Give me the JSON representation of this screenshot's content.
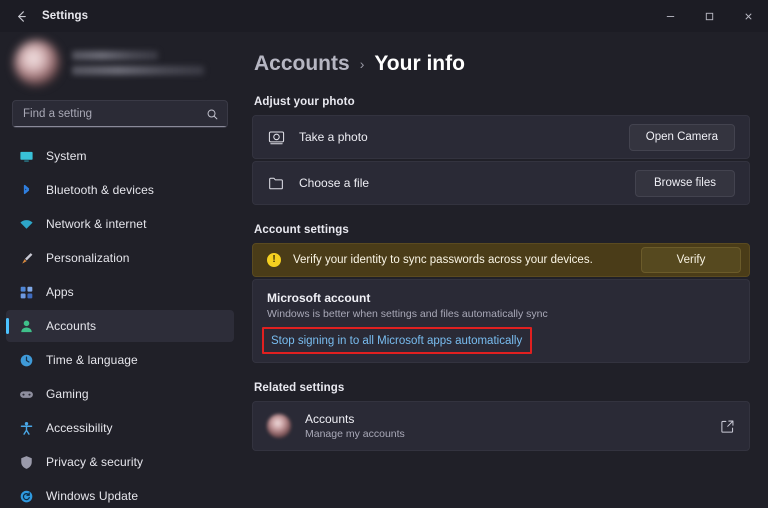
{
  "titlebar": {
    "back_icon": "back-arrow-icon",
    "title": "Settings",
    "minimize": "─",
    "maximize": "□",
    "close": "✕"
  },
  "sidebar": {
    "profile": {
      "avatar": "user-avatar-blurred",
      "name_blurred": true,
      "email_blurred": true
    },
    "search": {
      "placeholder": "Find a setting",
      "icon": "search-icon"
    },
    "items": [
      {
        "label": "System",
        "icon": "system-monitor-icon",
        "color": "#39c1d8",
        "active": false
      },
      {
        "label": "Bluetooth & devices",
        "icon": "bluetooth-icon",
        "color": "#2f7fe0",
        "active": false
      },
      {
        "label": "Network & internet",
        "icon": "wifi-icon",
        "color": "#2ea6c8",
        "active": false
      },
      {
        "label": "Personalization",
        "icon": "paintbrush-icon",
        "color": "#d98a3f",
        "active": false
      },
      {
        "label": "Apps",
        "icon": "apps-grid-icon",
        "color": "#4f86d6",
        "active": false
      },
      {
        "label": "Accounts",
        "icon": "account-person-icon",
        "color": "#3fc08a",
        "active": true
      },
      {
        "label": "Time & language",
        "icon": "clock-icon",
        "color": "#3f9ad8",
        "active": false
      },
      {
        "label": "Gaming",
        "icon": "gamepad-icon",
        "color": "#8e8e9e",
        "active": false
      },
      {
        "label": "Accessibility",
        "icon": "accessibility-person-icon",
        "color": "#4aa8e8",
        "active": false
      },
      {
        "label": "Privacy & security",
        "icon": "shield-icon",
        "color": "#9a9aaa",
        "active": false
      },
      {
        "label": "Windows Update",
        "icon": "update-refresh-icon",
        "color": "#2f9ae0",
        "active": false
      }
    ]
  },
  "main": {
    "breadcrumb": {
      "parent": "Accounts",
      "separator": "›",
      "current": "Your info"
    },
    "adjust_photo": {
      "section_title": "Adjust your photo",
      "rows": [
        {
          "label": "Take a photo",
          "icon": "camera-icon",
          "button": "Open Camera"
        },
        {
          "label": "Choose a file",
          "icon": "folder-icon",
          "button": "Browse files"
        }
      ]
    },
    "account_settings": {
      "section_title": "Account settings",
      "banner": {
        "icon": "warning-icon",
        "icon_glyph": "!",
        "text": "Verify your identity to sync passwords across your devices.",
        "button": "Verify",
        "background_color": "#4a3c18"
      },
      "microsoft_account": {
        "title": "Microsoft account",
        "subtitle": "Windows is better when settings and files automatically sync",
        "link": "Stop signing in to all Microsoft apps automatically",
        "link_color": "#79bdf0",
        "annotation_color": "#e02020"
      }
    },
    "related_settings": {
      "section_title": "Related settings",
      "row": {
        "avatar": "account-avatar-blurred",
        "title": "Accounts",
        "subtitle": "Manage my accounts",
        "icon": "external-link-icon"
      }
    }
  },
  "accent_color": "#4cc2ff"
}
